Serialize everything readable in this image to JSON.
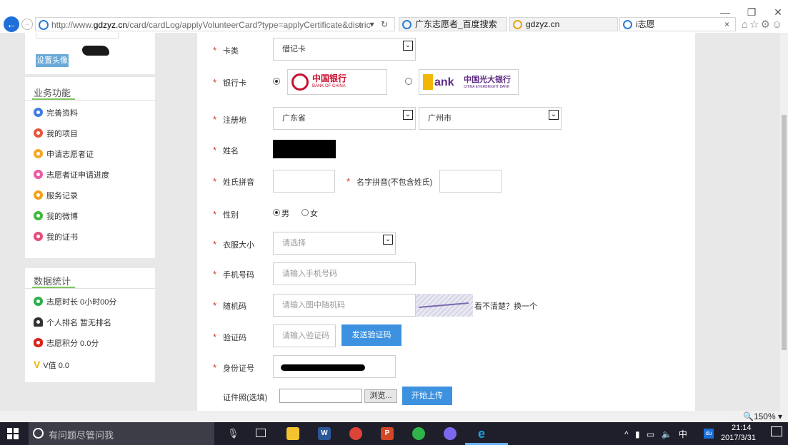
{
  "window": {
    "minimize": "—",
    "restore": "❐",
    "close": "✕"
  },
  "browser": {
    "url_prefix": "http://www.",
    "url_domain": "gdzyz.cn",
    "url_path": "/card/cardLog/applyVolunteerCard?type=applyCertificate&distric",
    "addr_tools": "⌕ ▾ ↻",
    "tabs": [
      {
        "label": "广东志愿者_百度搜索"
      },
      {
        "label": "gdzyz.cn"
      },
      {
        "label": "i志愿"
      }
    ],
    "tab_close": "×",
    "toolbar_icons": "⌂☆⚙☺"
  },
  "sidebar": {
    "set_avatar": "设置头像",
    "func_title": "业务功能",
    "func_items": [
      {
        "label": "完善资料",
        "color": "#3f7ee0"
      },
      {
        "label": "我的项目",
        "color": "#e8563e"
      },
      {
        "label": "申请志愿者证",
        "color": "#f4a724"
      },
      {
        "label": "志愿者证申请进度",
        "color": "#e95aa3"
      },
      {
        "label": "服务记录",
        "color": "#f3a21c"
      },
      {
        "label": "我的微博",
        "color": "#40ba3f"
      },
      {
        "label": "我的证书",
        "color": "#e64d7a"
      }
    ],
    "stats_title": "数据统计",
    "stats_items": [
      {
        "label": "志愿时长 0小时00分",
        "icon": "clock-icon",
        "color": "#2bb04a"
      },
      {
        "label": "个人排名 暂无排名",
        "icon": "person-icon",
        "color": "#333333"
      },
      {
        "label": "志愿积分 0.0分",
        "icon": "eye-icon",
        "color": "#d8261d"
      },
      {
        "label": "V值 0.0",
        "icon": "v-icon",
        "color": "#f0b400"
      }
    ]
  },
  "form": {
    "card_type": {
      "label": "卡类",
      "value": "借记卡"
    },
    "bank": {
      "label": "银行卡",
      "boc_name": "中国银行",
      "boc_en": "BANK OF CHINA",
      "ceb_word": "ank",
      "ceb_name": "中国光大银行",
      "ceb_en": "CHINA EVERBRIGHT BANK"
    },
    "region": {
      "label": "注册地",
      "province": "广东省",
      "city": "广州市"
    },
    "name": {
      "label": "姓名"
    },
    "surname_pinyin": {
      "label": "姓氏拼音"
    },
    "given_pinyin": {
      "label": "名字拼音(不包含姓氏)"
    },
    "gender": {
      "label": "性别",
      "male": "男",
      "female": "女"
    },
    "clothing": {
      "label": "衣服大小",
      "placeholder": "请选择"
    },
    "phone": {
      "label": "手机号码",
      "placeholder": "请输入手机号码"
    },
    "captcha": {
      "label": "随机码",
      "placeholder": "请输入图中随机码",
      "refresh": "看不清楚？换一个"
    },
    "sms_code": {
      "label": "验证码",
      "placeholder": "请输入验证码",
      "send": "发送验证码"
    },
    "id_number": {
      "label": "身份证号"
    },
    "photo": {
      "label": "证件照(选填)",
      "browse": "浏览...",
      "upload": "开始上传"
    },
    "required_mark": "*"
  },
  "zoom": "🔍150% ▾",
  "taskbar": {
    "search_text": "有问题尽管问我",
    "tray": "^ ▮ ▭ 🔈 中",
    "time": "21:14",
    "date": "2017/3/31"
  }
}
